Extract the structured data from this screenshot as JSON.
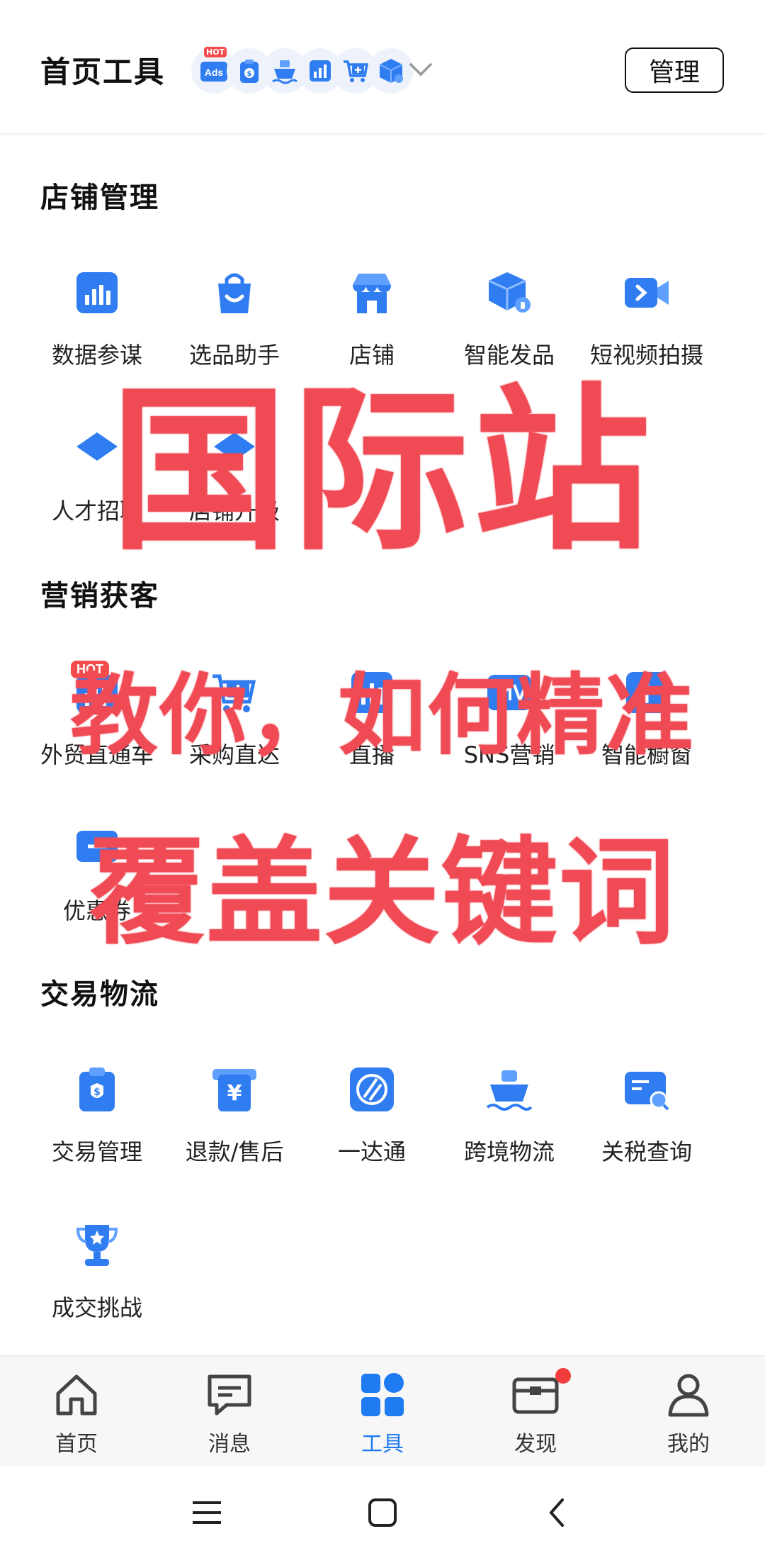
{
  "header": {
    "title": "首页工具",
    "manage_label": "管理",
    "shortcut_icons": [
      "ads-icon",
      "clipboard-dollar-icon",
      "ship-icon",
      "bar-chart-icon",
      "cart-plus-icon",
      "cube-icon"
    ],
    "shortcut_hot": "HOT",
    "shortcut_ads": "Ads"
  },
  "sections": {
    "store": {
      "title": "店铺管理",
      "items": [
        {
          "label": "数据参谋",
          "icon": "bar-chart-icon"
        },
        {
          "label": "选品助手",
          "icon": "shopping-bag-icon"
        },
        {
          "label": "店铺",
          "icon": "storefront-icon"
        },
        {
          "label": "智能发品",
          "icon": "cube-bulb-icon"
        },
        {
          "label": "短视频拍摄",
          "icon": "video-camera-icon"
        },
        {
          "label": "人才招聘",
          "icon": "diamond-icon"
        },
        {
          "label": "店铺升级",
          "icon": "diamond-up-icon"
        }
      ]
    },
    "marketing": {
      "title": "营销获客",
      "items": [
        {
          "label": "外贸直通车",
          "icon": "chart-hot-icon",
          "badge": "HOT"
        },
        {
          "label": "采购直达",
          "icon": "cart-plus-icon"
        },
        {
          "label": "直播",
          "icon": "live-chart-icon"
        },
        {
          "label": "SNS营销",
          "icon": "sns-icon"
        },
        {
          "label": "智能橱窗",
          "icon": "window-icon"
        },
        {
          "label": "优惠券",
          "icon": "coupon-icon"
        }
      ]
    },
    "trade": {
      "title": "交易物流",
      "items": [
        {
          "label": "交易管理",
          "icon": "clipboard-dollar-icon"
        },
        {
          "label": "退款/售后",
          "icon": "yuan-receipt-icon"
        },
        {
          "label": "一达通",
          "icon": "globe-icon"
        },
        {
          "label": "跨境物流",
          "icon": "ship-icon"
        },
        {
          "label": "关税查询",
          "icon": "card-search-icon"
        },
        {
          "label": "成交挑战",
          "icon": "trophy-icon"
        }
      ]
    }
  },
  "overlay": {
    "line1": "国际站",
    "line2": "教你，如何精准",
    "line3": "覆盖关键词",
    "color": "#f04a55"
  },
  "bottom_nav": {
    "items": [
      {
        "label": "首页",
        "icon": "home-icon"
      },
      {
        "label": "消息",
        "icon": "message-icon"
      },
      {
        "label": "工具",
        "icon": "tools-grid-icon",
        "active": true
      },
      {
        "label": "发现",
        "icon": "discover-box-icon",
        "dot": true
      },
      {
        "label": "我的",
        "icon": "profile-icon"
      }
    ],
    "active_color": "#1f7bf2"
  },
  "colors": {
    "accent": "#1f7bf2",
    "icon_blue": "#2f7df0",
    "hot_red": "#f24c4c"
  }
}
